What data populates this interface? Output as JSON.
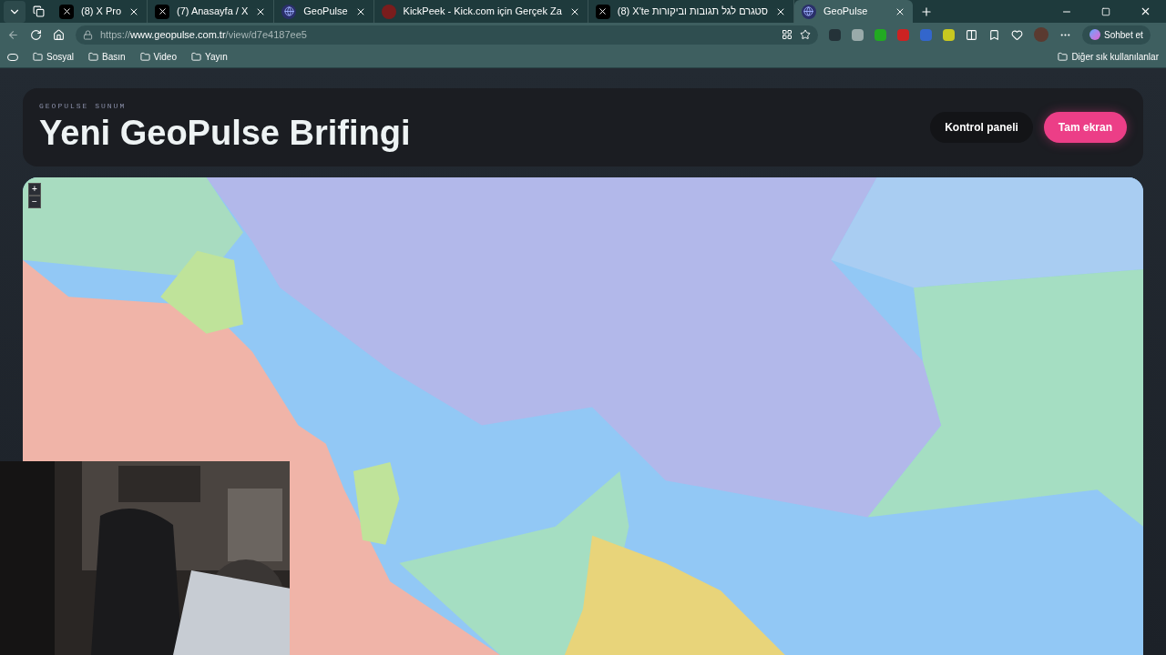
{
  "browser": {
    "tabs": [
      {
        "title": "(8) X Pro",
        "kind": "x",
        "selected": false
      },
      {
        "title": "(7) Anasayfa / X",
        "kind": "x",
        "selected": false
      },
      {
        "title": "GeoPulse",
        "kind": "globe",
        "selected": false
      },
      {
        "title": "KickPeek - Kick.com için Gerçek Za",
        "kind": "kick",
        "selected": false
      },
      {
        "title": "(8) X'te סטגרם לגל תגובות וביקורות",
        "kind": "x",
        "selected": false
      },
      {
        "title": "GeoPulse",
        "kind": "globe",
        "selected": true
      }
    ],
    "url_host": "https://www.geopulse.com.tr",
    "url_path": "/view/d7e4187ee5",
    "copilot_label": "Sohbet et",
    "bookmarks": [
      "Sosyal",
      "Basın",
      "Video",
      "Yayın"
    ],
    "other_bookmarks": "Diğer sık kullanılanlar"
  },
  "header": {
    "eyebrow": "GEOPULSE SUNUM",
    "title": "Yeni GeoPulse Brifingi",
    "buttons": [
      {
        "label": "Kontrol paneli",
        "kind": "secondary"
      },
      {
        "label": "Tam ekran",
        "kind": "primary"
      }
    ]
  },
  "map": {
    "kind": "picture",
    "zoom_controls": [
      "+",
      "−"
    ]
  }
}
